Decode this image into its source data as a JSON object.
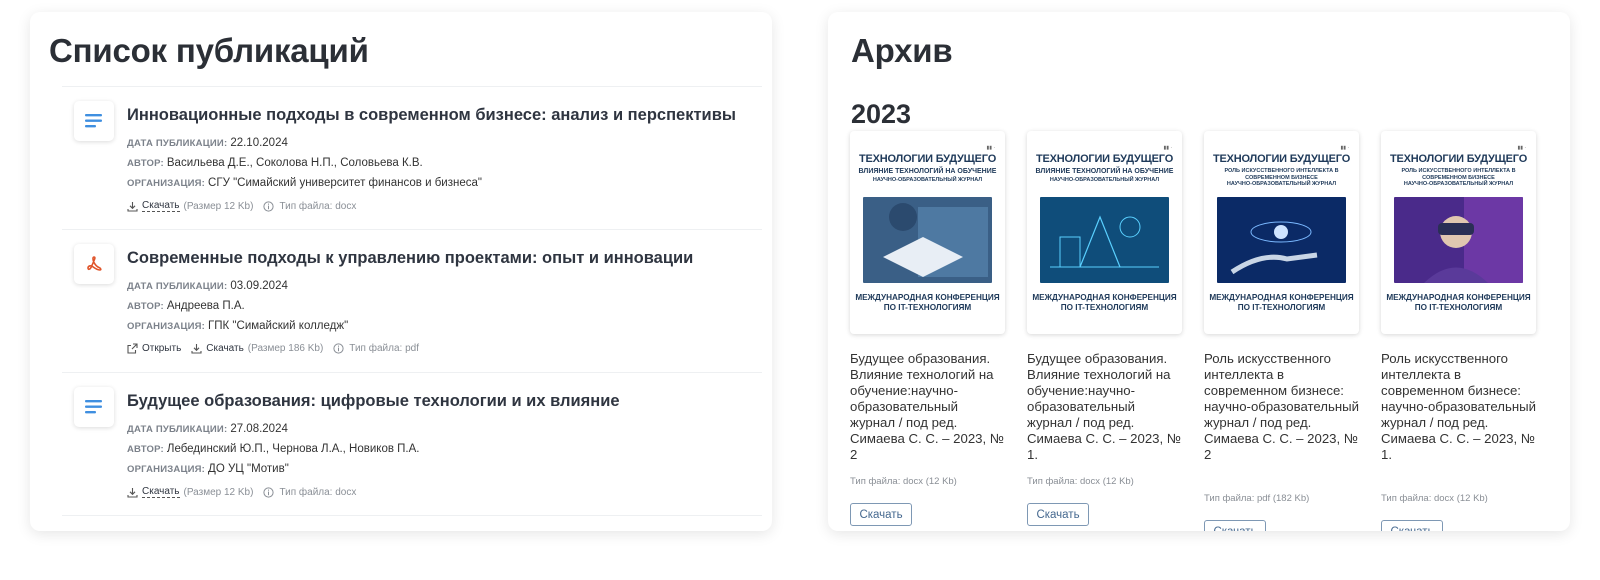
{
  "publications": {
    "title": "Список публикаций",
    "labels": {
      "date": "ДАТА ПУБЛИКАЦИИ:",
      "author": "АВТОР:",
      "org": "ОРГАНИЗАЦИЯ:",
      "open": "Открыть",
      "download": "Скачать",
      "filetype_prefix": "Тип файла:"
    },
    "items": [
      {
        "icon": "doc-lines-icon",
        "title": "Инновационные подходы в современном бизнесе: анализ и перспективы",
        "date": "22.10.2024",
        "author": "Васильева Д.Е., Соколова Н.П., Соловьева К.В.",
        "org": "СГУ \"Симайский университет финансов и бизнеса\"",
        "size": "(Размер 12 Kb)",
        "filetype": "Тип файла: docx"
      },
      {
        "icon": "pdf-acrobat-icon",
        "title": "Современные подходы к управлению проектами: опыт и инновации",
        "date": "03.09.2024",
        "author": "Андреева П.А.",
        "org": "ГПК \"Симайский колледж\"",
        "size": "(Размер 186 Kb)",
        "filetype": "Тип файла: pdf"
      },
      {
        "icon": "doc-lines-icon",
        "title": "Будущее образования: цифровые технологии и их влияние",
        "date": "27.08.2024",
        "author": "Лебединский Ю.П., Чернова Л.А., Новиков П.А.",
        "org": "ДО УЦ \"Мотив\"",
        "size": "(Размер 12 Kb)",
        "filetype": "Тип файла: docx"
      }
    ]
  },
  "archive": {
    "title": "Архив",
    "year": "2023",
    "download_label": "Скачать",
    "books": [
      {
        "cover_title": "ТЕХНОЛОГИИ БУДУЩЕГО",
        "cover_sub": "ВЛИЯНИЕ ТЕХНОЛОГИЙ НА ОБУЧЕНИЕ",
        "cover_sub2": "НАУЧНО-ОБРАЗОВАТЕЛЬНЫЙ ЖУРНАЛ",
        "cover_foot": "МЕЖДУНАРОДНАЯ КОНФЕРЕНЦИЯ ПО IT-ТЕХНОЛОГИЯМ",
        "title": "Будущее образования. Влияние технологий на обучение:научно-образовательный журнал / под ред. Симаева С. С. – 2023, № 2",
        "filetype": "Тип файла: docx (12 Kb)",
        "image_color": "#3a5f86"
      },
      {
        "cover_title": "ТЕХНОЛОГИИ БУДУЩЕГО",
        "cover_sub": "ВЛИЯНИЕ ТЕХНОЛОГИЙ НА ОБУЧЕНИЕ",
        "cover_sub2": "НАУЧНО-ОБРАЗОВАТЕЛЬНЫЙ ЖУРНАЛ",
        "cover_foot": "МЕЖДУНАРОДНАЯ КОНФЕРЕНЦИЯ ПО IT-ТЕХНОЛОГИЯМ",
        "title": "Будущее образования. Влияние технологий на обучение:научно-образовательный журнал / под ред. Симаева С. С. – 2023, № 1.",
        "filetype": "Тип файла: docx (12 Kb)",
        "image_color": "#0f4d7a"
      },
      {
        "cover_title": "ТЕХНОЛОГИИ БУДУЩЕГО",
        "cover_sub": "РОЛЬ ИСКУССТВЕННОГО ИНТЕЛЛЕКТА В СОВРЕМЕННОМ БИЗНЕСЕ",
        "cover_sub2": "НАУЧНО-ОБРАЗОВАТЕЛЬНЫЙ ЖУРНАЛ",
        "cover_foot": "МЕЖДУНАРОДНАЯ КОНФЕРЕНЦИЯ ПО IT-ТЕХНОЛОГИЯМ",
        "title": "Роль искусственного интеллекта в современном бизнесе: научно-образовательный журнал / под ред. Симаева С. С. – 2023, № 2",
        "filetype": "Тип файла: pdf (182 Kb)",
        "image_color": "#0b2a66"
      },
      {
        "cover_title": "ТЕХНОЛОГИИ БУДУЩЕГО",
        "cover_sub": "РОЛЬ ИСКУССТВЕННОГО ИНТЕЛЛЕКТА В СОВРЕМЕННОМ БИЗНЕСЕ",
        "cover_sub2": "НАУЧНО-ОБРАЗОВАТЕЛЬНЫЙ ЖУРНАЛ",
        "cover_foot": "МЕЖДУНАРОДНАЯ КОНФЕРЕНЦИЯ ПО IT-ТЕХНОЛОГИЯМ",
        "title": "Роль искусственного интеллекта в современном бизнесе: научно-образовательный журнал / под ред. Симаева С. С. – 2023, № 1.",
        "filetype": "Тип файла: docx (12 Kb)",
        "image_color": "#4a2a8a"
      }
    ]
  },
  "colors": {
    "doc_icon": "#3f8fe0",
    "pdf_icon": "#e0542a",
    "button_border": "#7e98b4",
    "button_text": "#45688f"
  }
}
